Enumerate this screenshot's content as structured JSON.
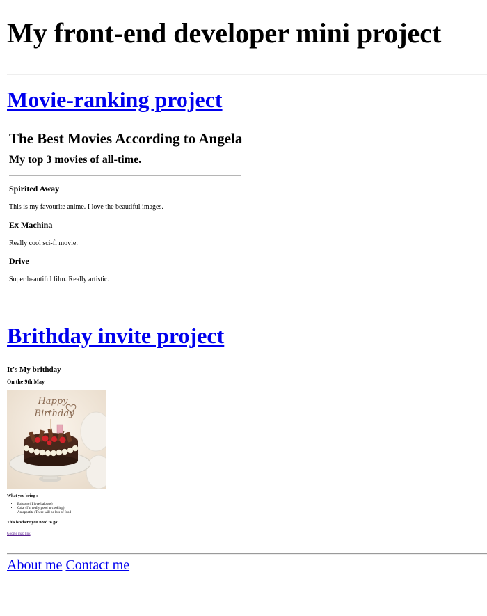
{
  "page": {
    "title": "My front-end developer mini project"
  },
  "projects": {
    "movie_link": "Movie-ranking project",
    "birthday_link": "Brithday invite project"
  },
  "movies": {
    "heading": "The Best Movies According to Angela",
    "subheading": "My top 3 movies of all-time.",
    "items": [
      {
        "title": "Spirited Away",
        "desc": "This is my favourite anime. I love the beautiful images."
      },
      {
        "title": "Ex Machina",
        "desc": "Really cool sci-fi movie."
      },
      {
        "title": "Drive",
        "desc": "Super beautiful film. Really artistic."
      }
    ]
  },
  "birthday": {
    "heading": "It's My brithday",
    "date": "On the 9th May",
    "image_topper_text": "Happy Birthday",
    "bring_heading": "What you bring :",
    "bring_items": [
      "Baloons ( I love baloons)",
      "Cake (I'm really good at cooking)",
      "An appetite (There will be lots of food"
    ],
    "where_heading": "This is where you need to go:",
    "map_link": "Google map link"
  },
  "footer": {
    "about": "About me",
    "contact": "Contact me"
  }
}
